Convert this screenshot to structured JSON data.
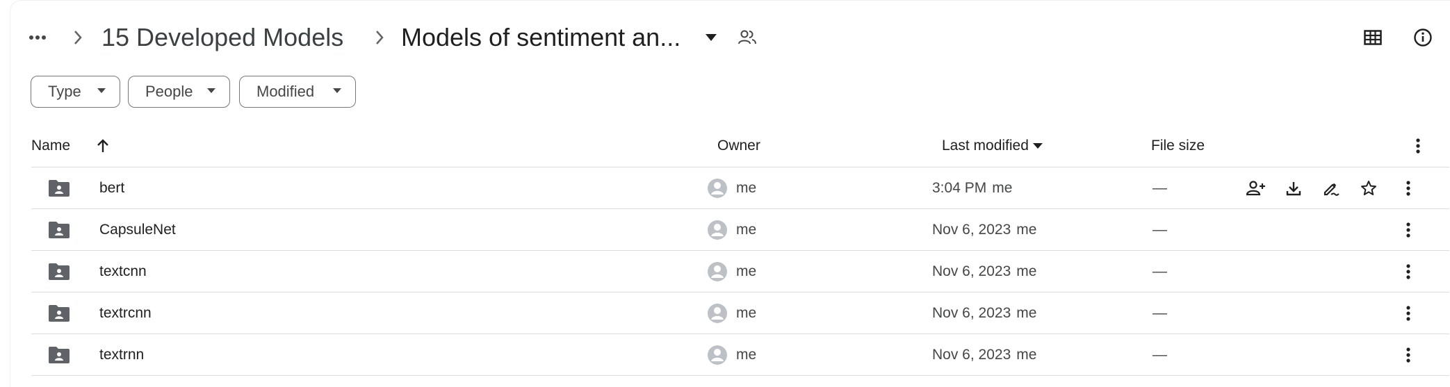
{
  "breadcrumb": {
    "more_label": "More",
    "parent": "15 Developed Models",
    "current": "Models of sentiment an..."
  },
  "filters": [
    {
      "label": "Type"
    },
    {
      "label": "People"
    },
    {
      "label": "Modified"
    }
  ],
  "columns": {
    "name": "Name",
    "owner": "Owner",
    "last_modified": "Last modified",
    "file_size": "File size"
  },
  "rows": [
    {
      "name": "bert",
      "owner": "me",
      "modified": "3:04 PM",
      "modified_by": "me",
      "size": "—"
    },
    {
      "name": "CapsuleNet",
      "owner": "me",
      "modified": "Nov 6, 2023",
      "modified_by": "me",
      "size": "—"
    },
    {
      "name": "textcnn",
      "owner": "me",
      "modified": "Nov 6, 2023",
      "modified_by": "me",
      "size": "—"
    },
    {
      "name": "textrcnn",
      "owner": "me",
      "modified": "Nov 6, 2023",
      "modified_by": "me",
      "size": "—"
    },
    {
      "name": "textrnn",
      "owner": "me",
      "modified": "Nov 6, 2023",
      "modified_by": "me",
      "size": "—"
    }
  ],
  "colors": {
    "text": "#1f1f1f",
    "secondary_text": "#444746",
    "icon": "#444746",
    "divider": "#dadce0",
    "avatar": "#bdc1c6",
    "folder": "#5f6368"
  },
  "icons": {
    "more": "more-horiz-icon",
    "chevron": "chevron-right-icon",
    "dropdown": "arrow-drop-down-icon",
    "shared": "people-icon",
    "grid_view": "grid-view-icon",
    "info": "info-icon",
    "sort": "arrow-up-icon",
    "row_actions": [
      "add-person-icon",
      "download-icon",
      "rename-icon",
      "star-icon",
      "more-vert-icon"
    ]
  }
}
